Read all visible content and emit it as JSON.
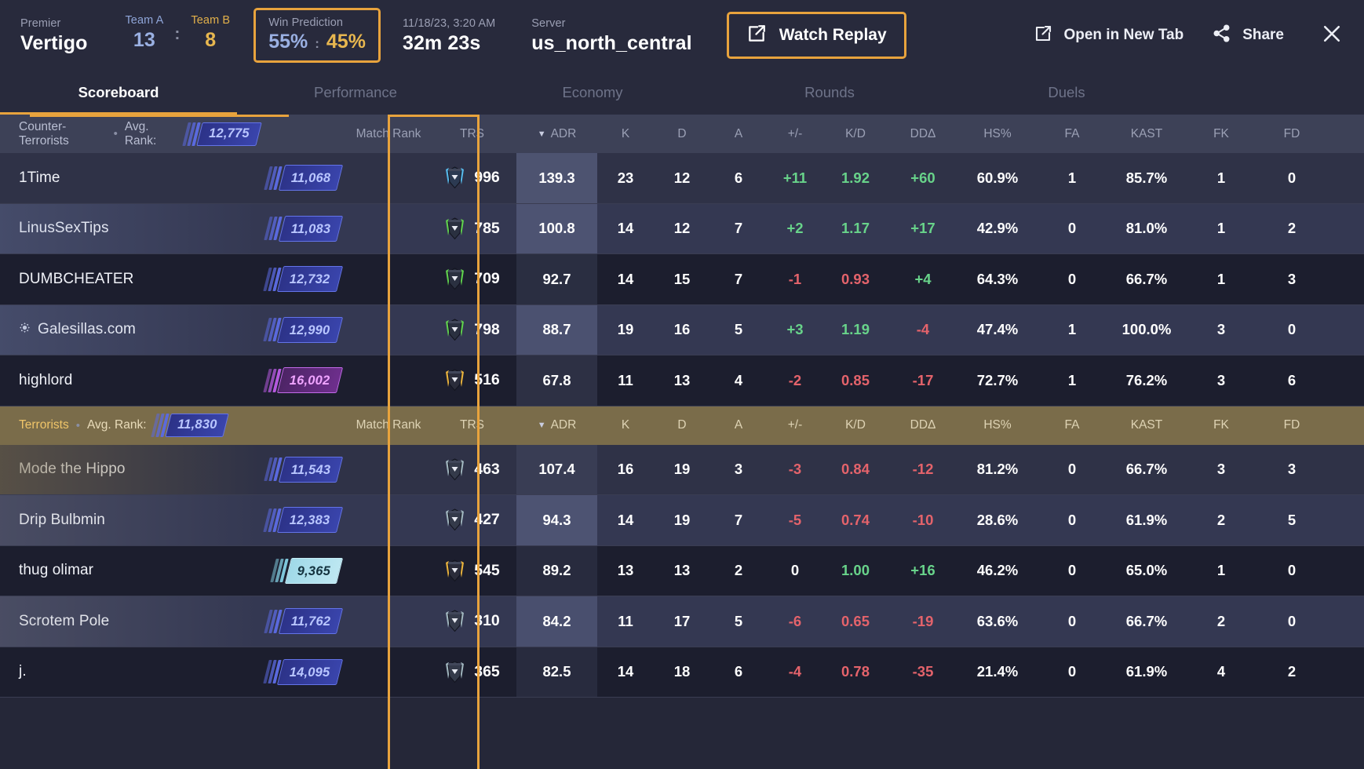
{
  "header": {
    "mode_label": "Premier",
    "map_name": "Vertigo",
    "team_a_label": "Team A",
    "team_a_score": "13",
    "score_separator": ":",
    "team_b_label": "Team B",
    "team_b_score": "8",
    "win_prediction_label": "Win Prediction",
    "win_prediction_a": "55%",
    "win_prediction_separator": ":",
    "win_prediction_b": "45%",
    "date_label": "11/18/23, 3:20 AM",
    "duration": "32m 23s",
    "server_label": "Server",
    "server_value": "us_north_central",
    "watch_replay_label": "Watch Replay",
    "open_new_tab_label": "Open in New Tab",
    "share_label": "Share",
    "accent_color": "#e8a33d",
    "team_a_color": "#9ab0e2",
    "team_b_color": "#e8b74f"
  },
  "tabs": [
    {
      "label": "Scoreboard",
      "active": true
    },
    {
      "label": "Performance",
      "active": false
    },
    {
      "label": "Economy",
      "active": false
    },
    {
      "label": "Rounds",
      "active": false
    },
    {
      "label": "Duels",
      "active": false
    }
  ],
  "columns": {
    "match_rank": "Match Rank",
    "trs": "TRS",
    "adr": "ADR",
    "k": "K",
    "d": "D",
    "a": "A",
    "pm": "+/-",
    "kd": "K/D",
    "dd": "DDΔ",
    "hs": "HS%",
    "fa": "FA",
    "kast": "KAST",
    "fk": "FK",
    "fd": "FD"
  },
  "sort": {
    "column": "ADR",
    "direction": "desc"
  },
  "teams": [
    {
      "side": "ct",
      "name": "Counter-Terrorists",
      "avg_rank_label": "Avg. Rank:",
      "avg_rank": "12,775",
      "avg_rank_tier": "blue",
      "players": [
        {
          "name": "1Time",
          "rank": "11,068",
          "rank_tier": "blue",
          "trs": "996",
          "trs_tier": "blue",
          "adr": "139.3",
          "adr_heat": 0.3,
          "k": "23",
          "d": "12",
          "a": "6",
          "pm": "+11",
          "pm_sign": "pos",
          "kd": "1.92",
          "kd_sign": "pos",
          "dd": "+60",
          "dd_sign": "pos",
          "hs": "60.9%",
          "fa": "1",
          "kast": "85.7%",
          "fk": "1",
          "fd": "0",
          "icon": null,
          "highlight": false
        },
        {
          "name": "LinusSexTips",
          "rank": "11,083",
          "rank_tier": "blue",
          "trs": "785",
          "trs_tier": "green",
          "adr": "100.8",
          "adr_heat": 0.26,
          "k": "14",
          "d": "12",
          "a": "7",
          "pm": "+2",
          "pm_sign": "pos",
          "kd": "1.17",
          "kd_sign": "pos",
          "dd": "+17",
          "dd_sign": "pos",
          "hs": "42.9%",
          "fa": "0",
          "kast": "81.0%",
          "fk": "1",
          "fd": "2",
          "icon": null,
          "highlight": true
        },
        {
          "name": "DUMBCHEATER",
          "rank": "12,732",
          "rank_tier": "blue",
          "trs": "709",
          "trs_tier": "green",
          "adr": "92.7",
          "adr_heat": 0.12,
          "k": "14",
          "d": "15",
          "a": "7",
          "pm": "-1",
          "pm_sign": "neg",
          "kd": "0.93",
          "kd_sign": "neg",
          "dd": "+4",
          "dd_sign": "pos",
          "hs": "64.3%",
          "fa": "0",
          "kast": "66.7%",
          "fk": "1",
          "fd": "3",
          "icon": null,
          "highlight": false
        },
        {
          "name": "Galesillas.com",
          "rank": "12,990",
          "rank_tier": "blue",
          "trs": "798",
          "trs_tier": "green",
          "adr": "88.7",
          "adr_heat": 0.24,
          "k": "19",
          "d": "16",
          "a": "5",
          "pm": "+3",
          "pm_sign": "pos",
          "kd": "1.19",
          "kd_sign": "pos",
          "dd": "-4",
          "dd_sign": "neg",
          "hs": "47.4%",
          "fa": "1",
          "kast": "100.0%",
          "fk": "3",
          "fd": "0",
          "icon": "gear-icon",
          "highlight": true
        },
        {
          "name": "highlord",
          "rank": "16,002",
          "rank_tier": "purple",
          "trs": "516",
          "trs_tier": "gold",
          "adr": "67.8",
          "adr_heat": 0.14,
          "k": "11",
          "d": "13",
          "a": "4",
          "pm": "-2",
          "pm_sign": "neg",
          "kd": "0.85",
          "kd_sign": "neg",
          "dd": "-17",
          "dd_sign": "neg",
          "hs": "72.7%",
          "fa": "1",
          "kast": "76.2%",
          "fk": "3",
          "fd": "6",
          "icon": null,
          "highlight": false
        }
      ]
    },
    {
      "side": "t",
      "name": "Terrorists",
      "avg_rank_label": "Avg. Rank:",
      "avg_rank": "11,830",
      "avg_rank_tier": "blue",
      "players": [
        {
          "name": "Mode the Hippo",
          "rank": "11,543",
          "rank_tier": "blue",
          "trs": "463",
          "trs_tier": "grey",
          "adr": "107.4",
          "adr_heat": 0.1,
          "k": "16",
          "d": "19",
          "a": "3",
          "pm": "-3",
          "pm_sign": "neg",
          "kd": "0.84",
          "kd_sign": "neg",
          "dd": "-12",
          "dd_sign": "neg",
          "hs": "81.2%",
          "fa": "0",
          "kast": "66.7%",
          "fk": "3",
          "fd": "3",
          "icon": null,
          "highlight": false
        },
        {
          "name": "Drip Bulbmin",
          "rank": "12,383",
          "rank_tier": "blue",
          "trs": "427",
          "trs_tier": "grey",
          "adr": "94.3",
          "adr_heat": 0.26,
          "k": "14",
          "d": "19",
          "a": "7",
          "pm": "-5",
          "pm_sign": "neg",
          "kd": "0.74",
          "kd_sign": "neg",
          "dd": "-10",
          "dd_sign": "neg",
          "hs": "28.6%",
          "fa": "0",
          "kast": "61.9%",
          "fk": "2",
          "fd": "5",
          "icon": null,
          "highlight": true
        },
        {
          "name": "thug olimar",
          "rank": "9,365",
          "rank_tier": "cyan",
          "trs": "545",
          "trs_tier": "gold",
          "adr": "89.2",
          "adr_heat": 0.1,
          "k": "13",
          "d": "13",
          "a": "2",
          "pm": "0",
          "pm_sign": "zero",
          "kd": "1.00",
          "kd_sign": "pos",
          "dd": "+16",
          "dd_sign": "pos",
          "hs": "46.2%",
          "fa": "0",
          "kast": "65.0%",
          "fk": "1",
          "fd": "0",
          "icon": null,
          "highlight": false
        },
        {
          "name": "Scrotem Pole",
          "rank": "11,762",
          "rank_tier": "blue",
          "trs": "310",
          "trs_tier": "grey",
          "adr": "84.2",
          "adr_heat": 0.22,
          "k": "11",
          "d": "17",
          "a": "5",
          "pm": "-6",
          "pm_sign": "neg",
          "kd": "0.65",
          "kd_sign": "neg",
          "dd": "-19",
          "dd_sign": "neg",
          "hs": "63.6%",
          "fa": "0",
          "kast": "66.7%",
          "fk": "2",
          "fd": "0",
          "icon": null,
          "highlight": true
        },
        {
          "name": "j.",
          "rank": "14,095",
          "rank_tier": "blue",
          "trs": "365",
          "trs_tier": "grey",
          "adr": "82.5",
          "adr_heat": 0.1,
          "k": "14",
          "d": "18",
          "a": "6",
          "pm": "-4",
          "pm_sign": "neg",
          "kd": "0.78",
          "kd_sign": "neg",
          "dd": "-35",
          "dd_sign": "neg",
          "hs": "21.4%",
          "fa": "0",
          "kast": "61.9%",
          "fk": "4",
          "fd": "2",
          "icon": null,
          "highlight": false
        }
      ]
    }
  ],
  "colors": {
    "positive": "#68d38a",
    "negative": "#e4636b",
    "accent": "#e8a33d",
    "bg": "#252738",
    "header_bg": "#282a3c",
    "t_header_bg": "#7a6c4a",
    "ct_header_bg": "#3d4157"
  }
}
